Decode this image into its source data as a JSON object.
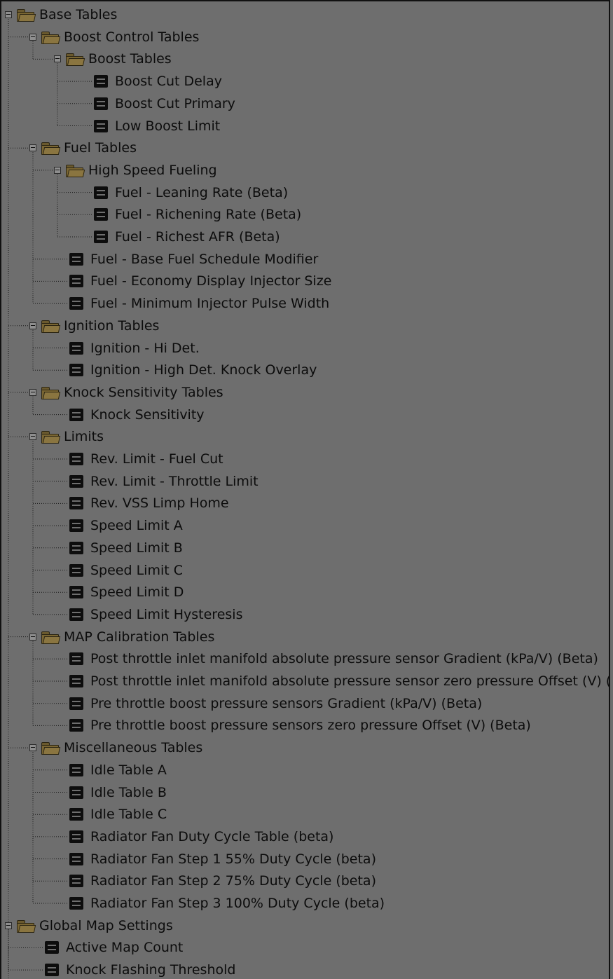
{
  "tree": [
    {
      "label": "Base Tables",
      "type": "folder",
      "depth": 0,
      "expanded": true
    },
    {
      "label": "Boost Control Tables",
      "type": "folder",
      "depth": 1,
      "expanded": true
    },
    {
      "label": "Boost Tables",
      "type": "folder",
      "depth": 2,
      "expanded": true
    },
    {
      "label": "Boost Cut Delay",
      "type": "table",
      "depth": 3
    },
    {
      "label": "Boost Cut Primary",
      "type": "table",
      "depth": 3
    },
    {
      "label": "Low Boost Limit",
      "type": "table",
      "depth": 3
    },
    {
      "label": "Fuel Tables",
      "type": "folder",
      "depth": 1,
      "expanded": true
    },
    {
      "label": "High Speed Fueling",
      "type": "folder",
      "depth": 2,
      "expanded": true
    },
    {
      "label": "Fuel - Leaning Rate (Beta)",
      "type": "table",
      "depth": 3
    },
    {
      "label": "Fuel - Richening Rate (Beta)",
      "type": "table",
      "depth": 3
    },
    {
      "label": "Fuel - Richest AFR (Beta)",
      "type": "table",
      "depth": 3
    },
    {
      "label": "Fuel - Base Fuel Schedule Modifier",
      "type": "table",
      "depth": 2
    },
    {
      "label": "Fuel - Economy Display Injector Size",
      "type": "table",
      "depth": 2
    },
    {
      "label": "Fuel - Minimum Injector Pulse Width",
      "type": "table",
      "depth": 2
    },
    {
      "label": "Ignition Tables",
      "type": "folder",
      "depth": 1,
      "expanded": true
    },
    {
      "label": "Ignition - Hi Det.",
      "type": "table",
      "depth": 2
    },
    {
      "label": "Ignition - High Det. Knock Overlay",
      "type": "table",
      "depth": 2
    },
    {
      "label": "Knock Sensitivity Tables",
      "type": "folder",
      "depth": 1,
      "expanded": true
    },
    {
      "label": "Knock Sensitivity",
      "type": "table",
      "depth": 2
    },
    {
      "label": "Limits",
      "type": "folder",
      "depth": 1,
      "expanded": true
    },
    {
      "label": "Rev. Limit - Fuel Cut",
      "type": "table",
      "depth": 2
    },
    {
      "label": "Rev. Limit - Throttle Limit",
      "type": "table",
      "depth": 2
    },
    {
      "label": "Rev. VSS Limp Home",
      "type": "table",
      "depth": 2
    },
    {
      "label": "Speed Limit A",
      "type": "table",
      "depth": 2
    },
    {
      "label": "Speed Limit B",
      "type": "table",
      "depth": 2
    },
    {
      "label": "Speed Limit C",
      "type": "table",
      "depth": 2
    },
    {
      "label": "Speed Limit D",
      "type": "table",
      "depth": 2
    },
    {
      "label": "Speed Limit Hysteresis",
      "type": "table",
      "depth": 2
    },
    {
      "label": "MAP Calibration Tables",
      "type": "folder",
      "depth": 1,
      "expanded": true
    },
    {
      "label": "Post throttle inlet manifold absolute pressure sensor Gradient (kPa/V) (Beta)",
      "type": "table",
      "depth": 2
    },
    {
      "label": "Post throttle inlet manifold absolute pressure sensor zero pressure Offset (V) (Beta)",
      "type": "table",
      "depth": 2
    },
    {
      "label": "Pre throttle boost pressure sensors Gradient (kPa/V) (Beta)",
      "type": "table",
      "depth": 2
    },
    {
      "label": "Pre throttle boost pressure sensors zero pressure Offset (V) (Beta)",
      "type": "table",
      "depth": 2
    },
    {
      "label": "Miscellaneous Tables",
      "type": "folder",
      "depth": 1,
      "expanded": true
    },
    {
      "label": "Idle Table A",
      "type": "table",
      "depth": 2
    },
    {
      "label": "Idle Table B",
      "type": "table",
      "depth": 2
    },
    {
      "label": "Idle Table C",
      "type": "table",
      "depth": 2
    },
    {
      "label": "Radiator Fan Duty Cycle Table (beta)",
      "type": "table",
      "depth": 2
    },
    {
      "label": "Radiator Fan Step 1 55% Duty Cycle (beta)",
      "type": "table",
      "depth": 2
    },
    {
      "label": "Radiator Fan Step 2 75% Duty Cycle (beta)",
      "type": "table",
      "depth": 2
    },
    {
      "label": "Radiator Fan Step 3 100% Duty Cycle (beta)",
      "type": "table",
      "depth": 2
    },
    {
      "label": "Global Map Settings",
      "type": "folder",
      "depth": 0,
      "expanded": true
    },
    {
      "label": "Active Map Count",
      "type": "table",
      "depth": 1
    },
    {
      "label": "Knock Flashing Threshold",
      "type": "table",
      "depth": 1
    }
  ]
}
